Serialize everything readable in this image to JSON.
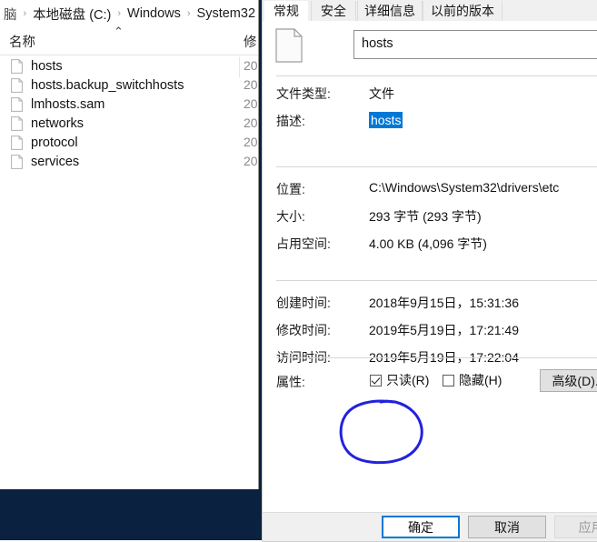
{
  "explorer": {
    "breadcrumb": {
      "items": [
        "脑",
        "本地磁盘 (C:)",
        "Windows",
        "System32"
      ],
      "separator": "›"
    },
    "columns": {
      "name": "名称",
      "date_modified": "修",
      "sort_arrow": "⌃"
    },
    "files": [
      {
        "name": "hosts",
        "date": "20"
      },
      {
        "name": "hosts.backup_switchhosts",
        "date": "20"
      },
      {
        "name": "lmhosts.sam",
        "date": "20"
      },
      {
        "name": "networks",
        "date": "20"
      },
      {
        "name": "protocol",
        "date": "20"
      },
      {
        "name": "services",
        "date": "20"
      }
    ]
  },
  "dialog": {
    "tabs": [
      {
        "label": "常规",
        "active": true
      },
      {
        "label": "安全",
        "active": false
      },
      {
        "label": "详细信息",
        "active": false
      },
      {
        "label": "以前的版本",
        "active": false
      }
    ],
    "file_name": "hosts",
    "properties": [
      {
        "label": "文件类型:",
        "value": "文件",
        "selected": false
      },
      {
        "label": "描述:",
        "value": "hosts",
        "selected": true
      },
      {
        "label": "位置:",
        "value": "C:\\Windows\\System32\\drivers\\etc",
        "selected": false
      },
      {
        "label": "大小:",
        "value": "293 字节 (293 字节)",
        "selected": false
      },
      {
        "label": "占用空间:",
        "value": "4.00 KB (4,096 字节)",
        "selected": false
      },
      {
        "label": "创建时间:",
        "value": "2018年9月15日，15:31:36",
        "selected": false
      },
      {
        "label": "修改时间:",
        "value": "2019年5月19日，17:21:49",
        "selected": false
      },
      {
        "label": "访问时间:",
        "value": "2019年5月19日，17:22:04",
        "selected": false
      }
    ],
    "attributes": {
      "label": "属性:",
      "readonly_label": "只读(R)",
      "readonly_checked": true,
      "hidden_label": "隐藏(H)",
      "hidden_checked": false,
      "advanced_label": "高级(D)..."
    },
    "footer": {
      "ok": "确定",
      "cancel": "取消",
      "apply": "应用("
    }
  },
  "annotation": {
    "shape": "hand-drawn-circle",
    "color": "#2222dd",
    "target": "只读(R)"
  },
  "colors": {
    "desktop": "#0a2240",
    "accent": "#0078d7",
    "selection": "#0078d7",
    "annotation": "#2222dd"
  }
}
